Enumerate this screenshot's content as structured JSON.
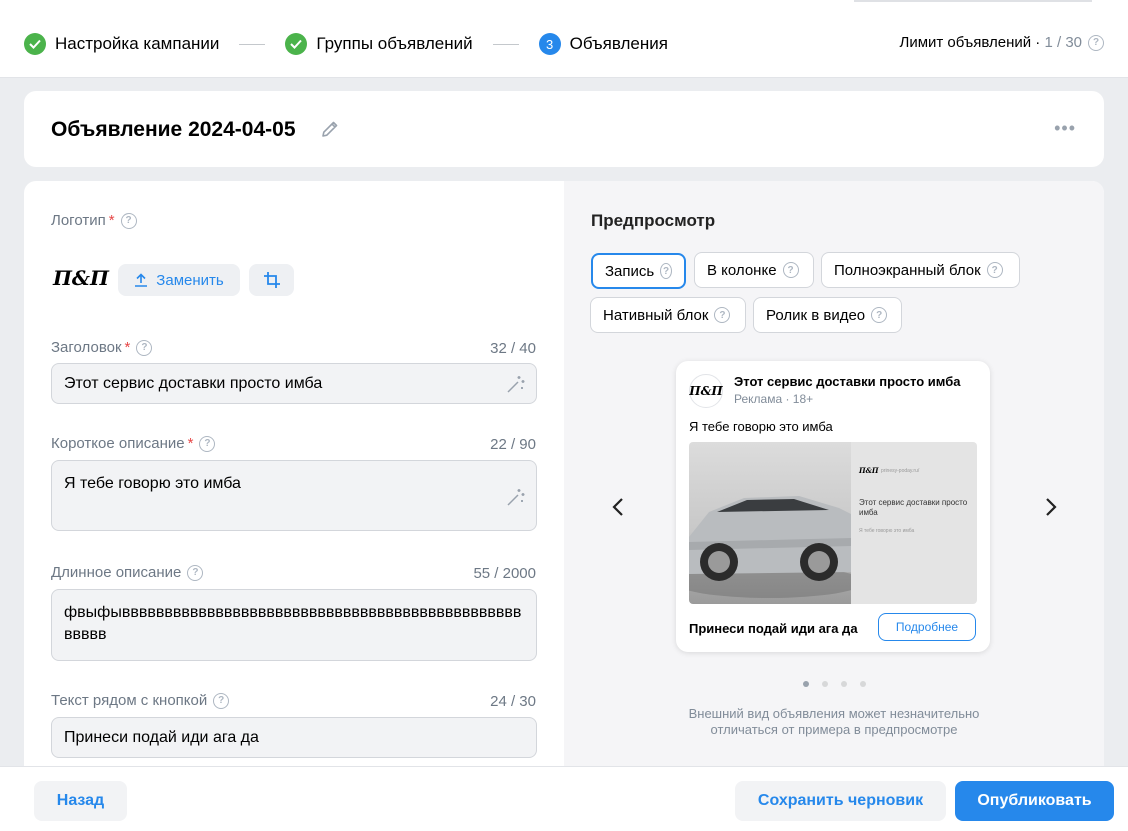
{
  "steps": [
    {
      "label": "Настройка кампании",
      "state": "done"
    },
    {
      "label": "Группы объявлений",
      "state": "done"
    },
    {
      "label": "Объявления",
      "state": "current",
      "number": "3"
    }
  ],
  "limit": {
    "label": "Лимит объявлений ·",
    "value": "1 / 30"
  },
  "ad": {
    "title": "Объявление 2024-04-05"
  },
  "form": {
    "logo_label": "Логотип",
    "logo_text": "П&П",
    "replace_label": "Заменить",
    "headline": {
      "label": "Заголовок",
      "counter": "32 / 40",
      "value": "Этот сервис доставки просто имба"
    },
    "short_desc": {
      "label": "Короткое описание",
      "counter": "22 / 90",
      "value": "Я тебе говорю это имба"
    },
    "long_desc": {
      "label": "Длинное описание",
      "counter": "55 / 2000",
      "value": "фвыфывввввввввввввввввввввввввввввввввввввввввввввввввввв"
    },
    "button_text": {
      "label": "Текст рядом с кнопкой",
      "counter": "24 / 30",
      "value": "Принеси подай иди ага да"
    }
  },
  "preview": {
    "title": "Предпросмотр",
    "chips": [
      "Запись",
      "В колонке",
      "Полноэкранный блок",
      "Нативный блок",
      "Ролик в видео"
    ],
    "active_chip": "Запись",
    "post": {
      "avatar_text": "П&П",
      "name": "Этот сервис доставки просто имба",
      "meta": "Реклама · 18+",
      "text": "Я тебе говорю это имба",
      "mini_logo": "П&П",
      "mini_url": "prinesy-poday.ru/",
      "mini_title": "Этот сервис доставки просто имба",
      "mini_text": "Я тебе говорю это имба",
      "cta_text": "Принеси подай иди ага да",
      "cta_button": "Подробнее"
    },
    "pager": {
      "count": 4,
      "active": 1
    },
    "note": "Внешний вид объявления может незначительно отличаться от примера в предпросмотре"
  },
  "footer": {
    "back": "Назад",
    "save_draft": "Сохранить черновик",
    "publish": "Опубликовать"
  },
  "colors": {
    "accent": "#2688eb",
    "success": "#4bb34b",
    "required": "#e64646"
  }
}
